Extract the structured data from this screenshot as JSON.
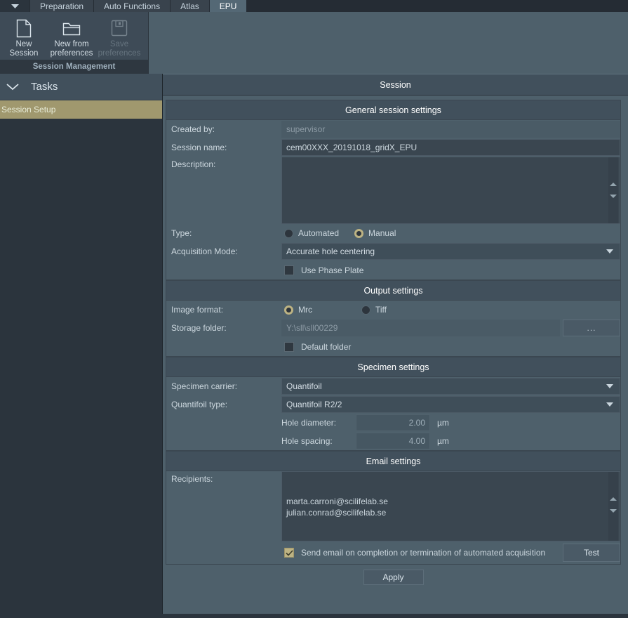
{
  "tabbar": {
    "menu_arrow_icon": "chevron-down-icon",
    "tabs": [
      {
        "label": "Preparation",
        "active": false
      },
      {
        "label": "Auto Functions",
        "active": false
      },
      {
        "label": "Atlas",
        "active": false
      },
      {
        "label": "EPU",
        "active": true
      }
    ]
  },
  "ribbon": {
    "group_title": "Session Management",
    "buttons": [
      {
        "label_line1": "New",
        "label_line2": "Session",
        "icon": "new-document-icon",
        "disabled": false
      },
      {
        "label_line1": "New from",
        "label_line2": "preferences",
        "icon": "open-folder-icon",
        "disabled": false
      },
      {
        "label_line1": "Save",
        "label_line2": "preferences",
        "icon": "floppy-disk-save-icon",
        "disabled": true
      }
    ]
  },
  "sidebar": {
    "header": "Tasks",
    "collapse_icon": "chevron-down-icon",
    "items": [
      {
        "label": "Session Setup",
        "active": true
      }
    ]
  },
  "main": {
    "title": "Session",
    "general": {
      "header": "General session settings",
      "created_by_label": "Created by:",
      "created_by_value": "supervisor",
      "session_name_label": "Session name:",
      "session_name_value": "cem00XXX_20191018_gridX_EPU",
      "description_label": "Description:",
      "description_value": "",
      "type_label": "Type:",
      "type_options": [
        {
          "label": "Automated",
          "selected": false
        },
        {
          "label": "Manual",
          "selected": true
        }
      ],
      "acquisition_mode_label": "Acquisition Mode:",
      "acquisition_mode_value": "Accurate hole centering",
      "use_phase_plate_label": "Use Phase Plate",
      "use_phase_plate_checked": false
    },
    "output": {
      "header": "Output settings",
      "image_format_label": "Image format:",
      "image_format_options": [
        {
          "label": "Mrc",
          "selected": true
        },
        {
          "label": "Tiff",
          "selected": false
        }
      ],
      "storage_folder_label": "Storage folder:",
      "storage_folder_value": "Y:\\sll\\sll00229",
      "browse_button_label": "...",
      "default_folder_label": "Default folder",
      "default_folder_checked": false
    },
    "specimen": {
      "header": "Specimen settings",
      "carrier_label": "Specimen carrier:",
      "carrier_value": "Quantifoil",
      "quantifoil_type_label": "Quantifoil type:",
      "quantifoil_type_value": "Quantifoil R2/2",
      "hole_diameter_label": "Hole diameter:",
      "hole_diameter_value": "2.00",
      "hole_diameter_unit": "µm",
      "hole_spacing_label": "Hole spacing:",
      "hole_spacing_value": "4.00",
      "hole_spacing_unit": "µm"
    },
    "email": {
      "header": "Email settings",
      "recipients_label": "Recipients:",
      "recipients": [
        "marta.carroni@scilifelab.se",
        "julian.conrad@scilifelab.se"
      ],
      "send_email_label": "Send email on completion or termination of automated acquisition",
      "send_email_checked": true,
      "test_button_label": "Test"
    },
    "apply_button_label": "Apply"
  },
  "colors": {
    "accent_selected": "#a0986e",
    "radio_checked": "#bdb383",
    "panel_bg": "#4e606b",
    "header_bg": "#41505c",
    "window_bg": "#2b343d",
    "tab_active_bg": "#546875"
  }
}
